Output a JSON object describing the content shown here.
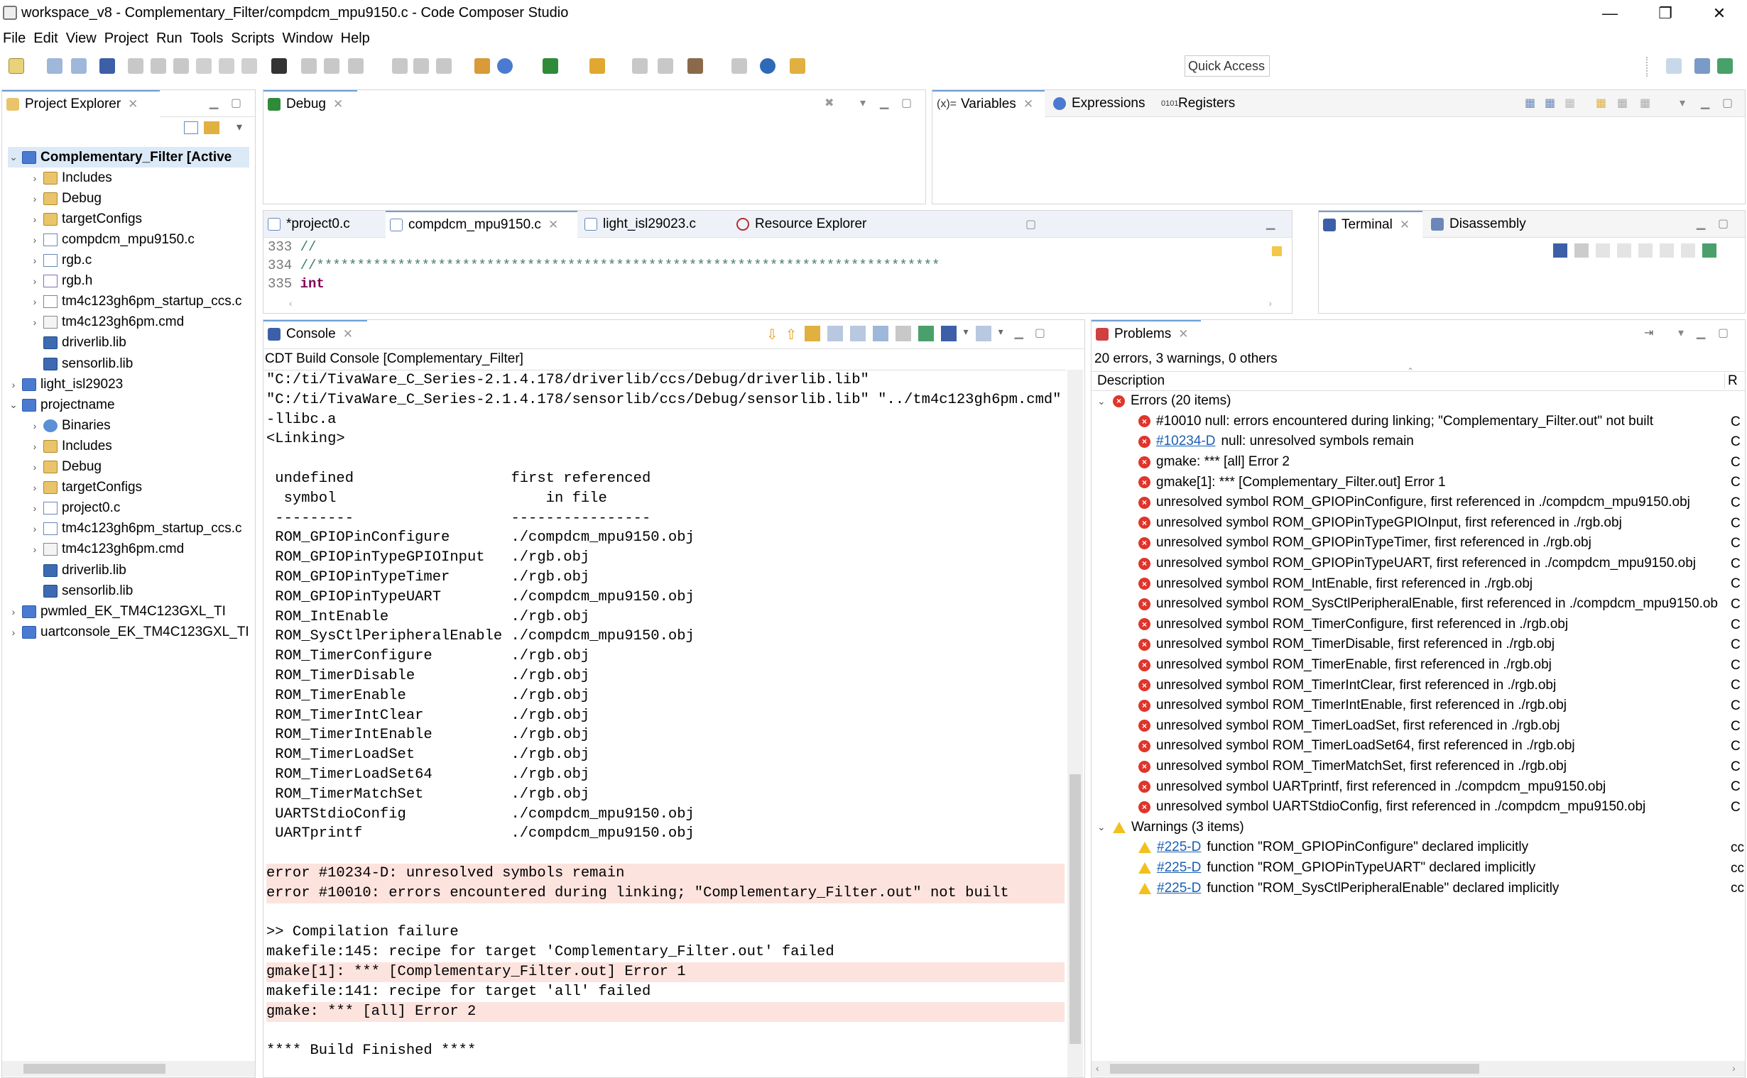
{
  "window": {
    "title": "workspace_v8 - Complementary_Filter/compdcm_mpu9150.c - Code Composer Studio",
    "minimize": "—",
    "restore": "❐",
    "close": "✕"
  },
  "menu": [
    "File",
    "Edit",
    "View",
    "Project",
    "Run",
    "Tools",
    "Scripts",
    "Window",
    "Help"
  ],
  "toolbar": {
    "quick_access": "Quick Access"
  },
  "project_explorer": {
    "tab": "Project Explorer",
    "items": [
      {
        "label": "Complementary_Filter  [Active",
        "icon": "project-icon",
        "kind": "proj",
        "level": 0,
        "twisty": "⌄",
        "bold": true
      },
      {
        "label": "Includes",
        "icon": "includes-icon",
        "kind": "folder",
        "level": 1,
        "twisty": "›"
      },
      {
        "label": "Debug",
        "icon": "folder-icon",
        "kind": "folder",
        "level": 1,
        "twisty": "›"
      },
      {
        "label": "targetConfigs",
        "icon": "folder-icon",
        "kind": "folder",
        "level": 1,
        "twisty": "›"
      },
      {
        "label": "compdcm_mpu9150.c",
        "icon": "c-file-icon",
        "kind": "cfile",
        "level": 1,
        "twisty": "›"
      },
      {
        "label": "rgb.c",
        "icon": "c-file-icon",
        "kind": "cfile",
        "level": 1,
        "twisty": "›"
      },
      {
        "label": "rgb.h",
        "icon": "h-file-icon",
        "kind": "hfile",
        "level": 1,
        "twisty": "›"
      },
      {
        "label": "tm4c123gh6pm_startup_ccs.c",
        "icon": "c-file-icon",
        "kind": "cfile",
        "level": 1,
        "twisty": "›"
      },
      {
        "label": "tm4c123gh6pm.cmd",
        "icon": "cmd-file-icon",
        "kind": "cmd",
        "level": 1,
        "twisty": "›"
      },
      {
        "label": "driverlib.lib",
        "icon": "library-icon",
        "kind": "lib",
        "level": 1,
        "twisty": ""
      },
      {
        "label": "sensorlib.lib",
        "icon": "library-icon",
        "kind": "lib",
        "level": 1,
        "twisty": ""
      },
      {
        "label": "light_isl29023",
        "icon": "project-icon",
        "kind": "proj",
        "level": 0,
        "twisty": "›"
      },
      {
        "label": "projectname",
        "icon": "project-icon",
        "kind": "proj",
        "level": 0,
        "twisty": "⌄"
      },
      {
        "label": "Binaries",
        "icon": "binaries-icon",
        "kind": "bin",
        "level": 1,
        "twisty": "›"
      },
      {
        "label": "Includes",
        "icon": "includes-icon",
        "kind": "folder",
        "level": 1,
        "twisty": "›"
      },
      {
        "label": "Debug",
        "icon": "folder-icon",
        "kind": "folder",
        "level": 1,
        "twisty": "›"
      },
      {
        "label": "targetConfigs",
        "icon": "folder-icon",
        "kind": "folder",
        "level": 1,
        "twisty": "›"
      },
      {
        "label": "project0.c",
        "icon": "c-file-icon",
        "kind": "cfile",
        "level": 1,
        "twisty": "›"
      },
      {
        "label": "tm4c123gh6pm_startup_ccs.c",
        "icon": "c-file-icon",
        "kind": "cfile",
        "level": 1,
        "twisty": "›"
      },
      {
        "label": "tm4c123gh6pm.cmd",
        "icon": "cmd-file-icon",
        "kind": "cmd",
        "level": 1,
        "twisty": "›"
      },
      {
        "label": "driverlib.lib",
        "icon": "library-icon",
        "kind": "lib",
        "level": 1,
        "twisty": ""
      },
      {
        "label": "sensorlib.lib",
        "icon": "library-icon",
        "kind": "lib",
        "level": 1,
        "twisty": ""
      },
      {
        "label": "pwmled_EK_TM4C123GXL_TI",
        "icon": "project-icon",
        "kind": "proj",
        "level": 0,
        "twisty": "›"
      },
      {
        "label": "uartconsole_EK_TM4C123GXL_TI",
        "icon": "project-icon",
        "kind": "proj",
        "level": 0,
        "twisty": "›"
      }
    ]
  },
  "debug_view": {
    "tab": "Debug"
  },
  "variables_view": {
    "tabs": [
      "Variables",
      "Expressions",
      "Registers"
    ],
    "tab_icons": [
      "(x)=",
      "",
      "0101"
    ]
  },
  "editor": {
    "tabs": [
      "*project0.c",
      "compdcm_mpu9150.c",
      "light_isl29023.c",
      "Resource Explorer"
    ],
    "lines": [
      {
        "num": "333",
        "text": "//"
      },
      {
        "num": "334",
        "text": "//*****************************************************************************"
      },
      {
        "num": "335",
        "text": "int"
      }
    ]
  },
  "terminal_view": {
    "tabs": [
      "Terminal",
      "Disassembly"
    ]
  },
  "console": {
    "tab": "Console",
    "header": "CDT Build Console [Complementary_Filter]",
    "lines": [
      {
        "text": "\"C:/ti/TivaWare_C_Series-2.1.4.178/driverlib/ccs/Debug/driverlib.lib\"",
        "err": false
      },
      {
        "text": "\"C:/ti/TivaWare_C_Series-2.1.4.178/sensorlib/ccs/Debug/sensorlib.lib\" \"../tm4c123gh6pm.cmd\"",
        "err": false
      },
      {
        "text": "-llibc.a",
        "err": false
      },
      {
        "text": "<Linking>",
        "err": false
      },
      {
        "text": "",
        "err": false
      },
      {
        "text": " undefined                  first referenced",
        "err": false
      },
      {
        "text": "  symbol                        in file",
        "err": false
      },
      {
        "text": " ---------                  ----------------",
        "err": false
      },
      {
        "text": " ROM_GPIOPinConfigure       ./compdcm_mpu9150.obj",
        "err": false
      },
      {
        "text": " ROM_GPIOPinTypeGPIOInput   ./rgb.obj",
        "err": false
      },
      {
        "text": " ROM_GPIOPinTypeTimer       ./rgb.obj",
        "err": false
      },
      {
        "text": " ROM_GPIOPinTypeUART        ./compdcm_mpu9150.obj",
        "err": false
      },
      {
        "text": " ROM_IntEnable              ./rgb.obj",
        "err": false
      },
      {
        "text": " ROM_SysCtlPeripheralEnable ./compdcm_mpu9150.obj",
        "err": false
      },
      {
        "text": " ROM_TimerConfigure         ./rgb.obj",
        "err": false
      },
      {
        "text": " ROM_TimerDisable           ./rgb.obj",
        "err": false
      },
      {
        "text": " ROM_TimerEnable            ./rgb.obj",
        "err": false
      },
      {
        "text": " ROM_TimerIntClear          ./rgb.obj",
        "err": false
      },
      {
        "text": " ROM_TimerIntEnable         ./rgb.obj",
        "err": false
      },
      {
        "text": " ROM_TimerLoadSet           ./rgb.obj",
        "err": false
      },
      {
        "text": " ROM_TimerLoadSet64         ./rgb.obj",
        "err": false
      },
      {
        "text": " ROM_TimerMatchSet          ./rgb.obj",
        "err": false
      },
      {
        "text": " UARTStdioConfig            ./compdcm_mpu9150.obj",
        "err": false
      },
      {
        "text": " UARTprintf                 ./compdcm_mpu9150.obj",
        "err": false
      },
      {
        "text": "",
        "err": false
      },
      {
        "text": "error #10234-D: unresolved symbols remain",
        "err": true
      },
      {
        "text": "error #10010: errors encountered during linking; \"Complementary_Filter.out\" not built",
        "err": true
      },
      {
        "text": "",
        "err": false
      },
      {
        "text": ">> Compilation failure",
        "err": false
      },
      {
        "text": "makefile:145: recipe for target 'Complementary_Filter.out' failed",
        "err": false
      },
      {
        "text": "gmake[1]: *** [Complementary_Filter.out] Error 1",
        "err": true
      },
      {
        "text": "makefile:141: recipe for target 'all' failed",
        "err": false
      },
      {
        "text": "gmake: *** [all] Error 2",
        "err": true
      },
      {
        "text": "",
        "err": false
      },
      {
        "text": "**** Build Finished ****",
        "err": false
      }
    ]
  },
  "problems": {
    "tab": "Problems",
    "summary": "20 errors, 3 warnings, 0 others",
    "col_description": "Description",
    "col_resource": "R",
    "errors_group": "Errors (20 items)",
    "warnings_group": "Warnings (3 items)",
    "errors": [
      {
        "link": "",
        "text": "#10010 null: errors encountered during linking; \"Complementary_Filter.out\" not built"
      },
      {
        "link": "#10234-D",
        "text": "null: unresolved symbols remain"
      },
      {
        "link": "",
        "text": "gmake: *** [all] Error 2"
      },
      {
        "link": "",
        "text": "gmake[1]: *** [Complementary_Filter.out] Error 1"
      },
      {
        "link": "",
        "text": "unresolved symbol ROM_GPIOPinConfigure, first referenced in ./compdcm_mpu9150.obj"
      },
      {
        "link": "",
        "text": "unresolved symbol ROM_GPIOPinTypeGPIOInput, first referenced in ./rgb.obj"
      },
      {
        "link": "",
        "text": "unresolved symbol ROM_GPIOPinTypeTimer, first referenced in ./rgb.obj"
      },
      {
        "link": "",
        "text": "unresolved symbol ROM_GPIOPinTypeUART, first referenced in ./compdcm_mpu9150.obj"
      },
      {
        "link": "",
        "text": "unresolved symbol ROM_IntEnable, first referenced in ./rgb.obj"
      },
      {
        "link": "",
        "text": "unresolved symbol ROM_SysCtlPeripheralEnable, first referenced in ./compdcm_mpu9150.ob"
      },
      {
        "link": "",
        "text": "unresolved symbol ROM_TimerConfigure, first referenced in ./rgb.obj"
      },
      {
        "link": "",
        "text": "unresolved symbol ROM_TimerDisable, first referenced in ./rgb.obj"
      },
      {
        "link": "",
        "text": "unresolved symbol ROM_TimerEnable, first referenced in ./rgb.obj"
      },
      {
        "link": "",
        "text": "unresolved symbol ROM_TimerIntClear, first referenced in ./rgb.obj"
      },
      {
        "link": "",
        "text": "unresolved symbol ROM_TimerIntEnable, first referenced in ./rgb.obj"
      },
      {
        "link": "",
        "text": "unresolved symbol ROM_TimerLoadSet, first referenced in ./rgb.obj"
      },
      {
        "link": "",
        "text": "unresolved symbol ROM_TimerLoadSet64, first referenced in ./rgb.obj"
      },
      {
        "link": "",
        "text": "unresolved symbol ROM_TimerMatchSet, first referenced in ./rgb.obj"
      },
      {
        "link": "",
        "text": "unresolved symbol UARTprintf, first referenced in ./compdcm_mpu9150.obj"
      },
      {
        "link": "",
        "text": "unresolved symbol UARTStdioConfig, first referenced in ./compdcm_mpu9150.obj"
      }
    ],
    "warnings": [
      {
        "link": "#225-D",
        "text": "function \"ROM_GPIOPinConfigure\" declared implicitly"
      },
      {
        "link": "#225-D",
        "text": "function \"ROM_GPIOPinTypeUART\" declared implicitly"
      },
      {
        "link": "#225-D",
        "text": "function \"ROM_SysCtlPeripheralEnable\" declared implicitly"
      }
    ],
    "resource_cut_err": "C",
    "resource_cut_warn": "cc"
  },
  "colors": {
    "error_bg": "#fde3de",
    "error_icon": "#e0352b",
    "warning_icon": "#f2c01e",
    "link": "#1a5fb4",
    "active_tab_accent": "#6e9fd6",
    "keyword": "#7f0055",
    "comment": "#3f7f5f"
  }
}
